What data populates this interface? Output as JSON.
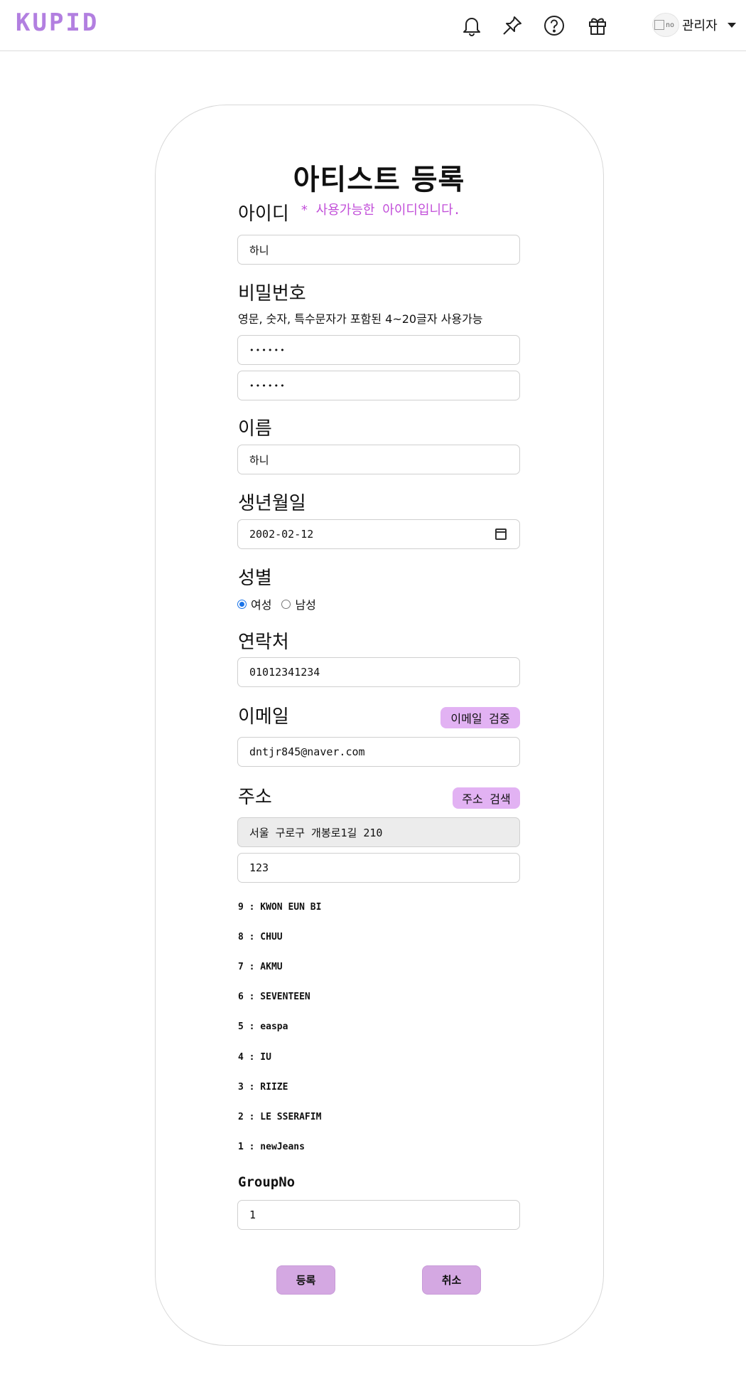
{
  "header": {
    "logo": "KUPID",
    "icons": [
      "bell-icon",
      "pin-icon",
      "help-icon",
      "gift-icon"
    ],
    "avatar_alt": "no",
    "user_name": "관리자"
  },
  "form": {
    "title": "아티스트 등록",
    "id": {
      "label": "아이디",
      "status": "* 사용가능한 아이디입니다.",
      "value": "하니"
    },
    "password": {
      "label": "비밀번호",
      "hint": "영문, 숫자, 특수문자가 포함된 4~20글자 사용가능",
      "value": "••••••",
      "confirm_value": "••••••"
    },
    "name": {
      "label": "이름",
      "value": "하니"
    },
    "birth": {
      "label": "생년월일",
      "value": "2002-02-12"
    },
    "gender": {
      "label": "성별",
      "options": [
        "여성",
        "남성"
      ],
      "selected": "여성"
    },
    "phone": {
      "label": "연락처",
      "value": "01012341234"
    },
    "email": {
      "label": "이메일",
      "verify_button": "이메일 검증",
      "value": "dntjr845@naver.com"
    },
    "address": {
      "label": "주소",
      "search_button": "주소 검색",
      "value": "서울 구로구 개봉로1길 210",
      "detail": "123"
    },
    "groups": [
      "9 : KWON EUN BI",
      "8 : CHUU",
      "7 : AKMU",
      "6 : SEVENTEEN",
      "5 : easpa",
      "4 : IU",
      "3 : RIIZE",
      "2 : LE SSERAFIM",
      "1 : newJeans"
    ],
    "group_no": {
      "label": "GroupNo",
      "value": "1"
    },
    "submit_label": "등록",
    "cancel_label": "취소"
  },
  "colors": {
    "brand": "#b27fe0",
    "accent_button": "#d4a8e2",
    "pill": "#e2b2f3",
    "status_text": "#c24fd9",
    "radio_on": "#1a73e8"
  }
}
